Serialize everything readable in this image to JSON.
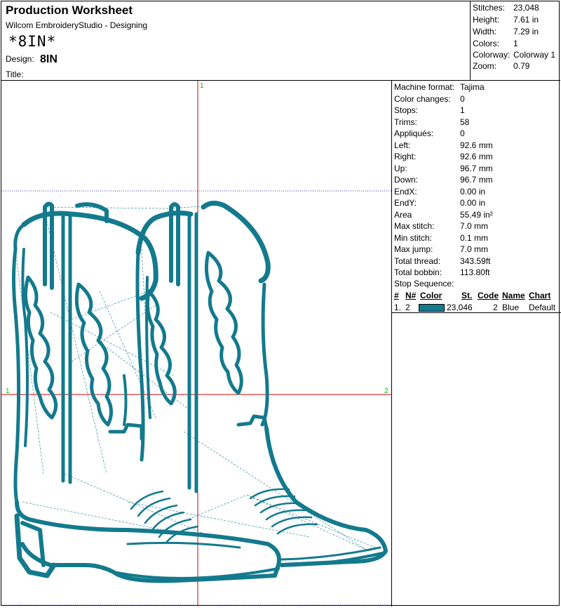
{
  "header": {
    "title": "Production Worksheet",
    "subtitle": "Wilcom EmbroideryStudio - Designing",
    "code": "*8IN*",
    "design_label": "Design:",
    "design_value": "8IN",
    "title_label": "Title:"
  },
  "stats": [
    {
      "label": "Stitches:",
      "value": "23,048"
    },
    {
      "label": "Height:",
      "value": "7.61 in"
    },
    {
      "label": "Width:",
      "value": "7.29 in"
    },
    {
      "label": "Colors:",
      "value": "1"
    },
    {
      "label": "Colorway:",
      "value": "Colorway 1"
    },
    {
      "label": "Zoom:",
      "value": "0.79"
    }
  ],
  "info": [
    {
      "label": "Machine format:",
      "value": "Tajima"
    },
    {
      "label": "Color changes:",
      "value": "0"
    },
    {
      "label": "Stops:",
      "value": "1"
    },
    {
      "label": "Trims:",
      "value": "58"
    },
    {
      "label": "Appliqués:",
      "value": "0"
    },
    {
      "label": "Left:",
      "value": "92.6 mm"
    },
    {
      "label": "Right:",
      "value": "92.6 mm"
    },
    {
      "label": "Up:",
      "value": "96.7 mm"
    },
    {
      "label": "Down:",
      "value": "96.7 mm"
    },
    {
      "label": "EndX:",
      "value": "0.00 in"
    },
    {
      "label": "EndY:",
      "value": "0.00 in"
    },
    {
      "label": "Area",
      "value": "55.49 in²"
    },
    {
      "label": "Max stitch:",
      "value": "7.0 mm"
    },
    {
      "label": "Min stitch:",
      "value": "0.1 mm"
    },
    {
      "label": "Max jump:",
      "value": "7.0 mm"
    },
    {
      "label": "Total thread:",
      "value": "343.59ft"
    },
    {
      "label": "Total bobbin:",
      "value": "113.80ft"
    }
  ],
  "stop_sequence": {
    "title": "Stop Sequence:",
    "headers": {
      "num": "#",
      "n": "N#",
      "color": "Color",
      "st": "St.",
      "code": "Code",
      "name": "Name",
      "chart": "Chart"
    },
    "rows": [
      {
        "num": "1.",
        "n": "2",
        "color_hex": "#137a8d",
        "st": "23,046",
        "code": "2",
        "name": "Blue",
        "chart": "Default"
      }
    ]
  },
  "markers": {
    "top": "1",
    "left": "1",
    "right": "2"
  },
  "colors": {
    "thread": "#137a8d",
    "crosshair": "#d40000",
    "guide": "#3333cc",
    "marker": "#00c000"
  }
}
